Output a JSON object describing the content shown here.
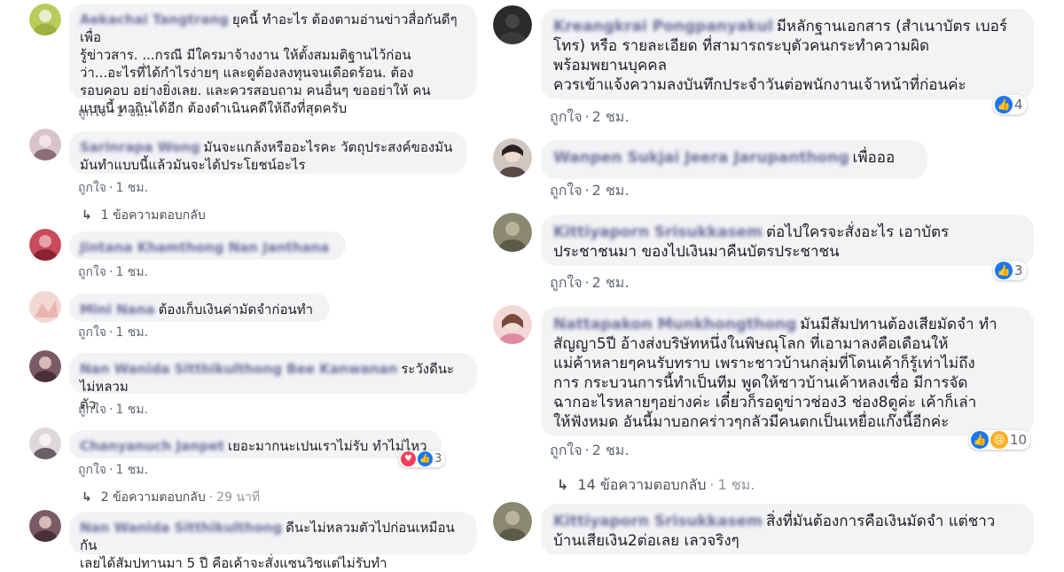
{
  "ui": {
    "like_label": "ถูกใจ",
    "dot": "·"
  },
  "left": [
    {
      "author": "Aekachai Tangtrang",
      "text": "ยุคนี้ ทำอะไร ต้องตามอ่านข่าวสื่อกันดีๆเพื่อ\nรู้ข่าวสาร. ...กรณี มีใครมาจ้างงาน ให้ตั้งสมมติฐานไว้ก่อน\nว่า...อะไรที่ได้กำไรง่ายๆ และดูต้องลงทุนจนเดือดร้อน. ต้อง\nรอบคอบ อย่างยิ่งเลย. และควรสอบถาม คนอื่นๆ ขออย่าให้ คน\nแบบนี้ หากินได้อีก ต้องดำเนินคดีให้ถึงที่สุดครับ",
      "time": "1 ชม."
    },
    {
      "author": "Sarinrapa Wong",
      "text": "มันจะแกล้งหรืออะไรคะ วัตถุประสงค์ของมัน\nมันทำแบบนี้แล้วมันจะได้ประโยชน์อะไร",
      "time": "1 ชม.",
      "replies": {
        "label": "1 ข้อความตอบกลับ",
        "time": ""
      }
    },
    {
      "author": "Jintana Khamthong Nan Janthana",
      "text": "",
      "time": "1 ชม."
    },
    {
      "author": "Mini Nana",
      "text": "ต้องเก็บเงินค่ามัดจำก่อนทำ",
      "time": "1 ชม."
    },
    {
      "author": "Nan Wanida Sitthikulthong Bee Kanwanan",
      "text": "ระวังดีนะไม่หลวม\nตัว",
      "time": "1 ชม."
    },
    {
      "author": "Chanyanuch Janpet",
      "text": "เยอะมากนะเปนเราไม่รับ ทำไม่ไหว",
      "time": "1 ชม.",
      "reactions": {
        "icons": [
          "love-icon",
          "like-icon"
        ],
        "count": "3"
      },
      "replies": {
        "label": "2 ข้อความตอบกลับ",
        "time": "29 นาที"
      }
    },
    {
      "author": "Nan Wanida Sitthikulthong",
      "text": "ดีนะไม่หลวมตัวไปก่อนเหมือนกัน\nเลยได้สัมปทานมา 5 ปี คือเค้าจะสั่งแซนวิชแต่ไม่รับทำ",
      "time": ""
    }
  ],
  "right": [
    {
      "author": "Kreangkrai Pongpanyakul",
      "text": "มีหลักฐานเอกสาร (สำเนาบัตร เบอร์\nโทร) หรือ รายละเอียด ที่สามารถระบุตัวคนกระทำความผิด\nพร้อมพยานบุคคล\nควรเข้าแจ้งความลงบันทึกประจำวันต่อพนักงานเจ้าหน้าที่ก่อนค่ะ",
      "time": "2 ชม.",
      "reactions": {
        "icons": [
          "like-icon"
        ],
        "count": "4"
      }
    },
    {
      "author": "Wanpen Sukjai Jeera Jarupanthong",
      "text": "เพื่อออ",
      "time": "2 ชม."
    },
    {
      "author": "Kittiyaporn Srisukkasem",
      "text": "ต่อไปใครจะสั่งอะไร เอาบัตร\nประชาชนมา ของไปเงินมาคืนบัตรประชาชน",
      "time": "2 ชม.",
      "reactions": {
        "icons": [
          "like-icon"
        ],
        "count": "3"
      }
    },
    {
      "author": "Nattapakon Munkhongthong",
      "text": "มันมีสัมปทานต้องเสียมัดจำ ทำ\nสัญญา5ปี อ้างส่งบริษัทหนึ่งในพิษณุโลก ที่เอามาลงคือเดือนให้\nแม่ค้าหลายๆคนรับทราบ เพราะชาวบ้านกลุ่มที่โดนเค้าก็รู้เท่าไม่ถึง\nการ กระบวนการนี้ทำเป็นทีม พูดให้ชาวบ้านเค้าหลงเชื่อ มีการจัด\nฉากอะไรหลายๆอย่างค่ะ เดี๋ยวก็รอดูข่าวช่อง3 ช่อง8ดูค่ะ เค้าก็เล่า\nให้ฟังหมด อันนี้มาบอกคร่าวๆกลัวมีคนตกเป็นเหยื่อแก๊งนี้อีกค่ะ",
      "time": "2 ชม.",
      "reactions": {
        "icons": [
          "like-icon",
          "sad-icon"
        ],
        "count": "10"
      },
      "replies": {
        "label": "14 ข้อความตอบกลับ",
        "time": "1 ชม."
      }
    },
    {
      "author": "Kittiyaporn Srisukkasem",
      "text": "สิ่งที่มันต้องการคือเงินมัดจำ แต่ชาว\nบ้านเสียเงิน2ต่อเลย เลวจริงๆ",
      "time": ""
    }
  ]
}
